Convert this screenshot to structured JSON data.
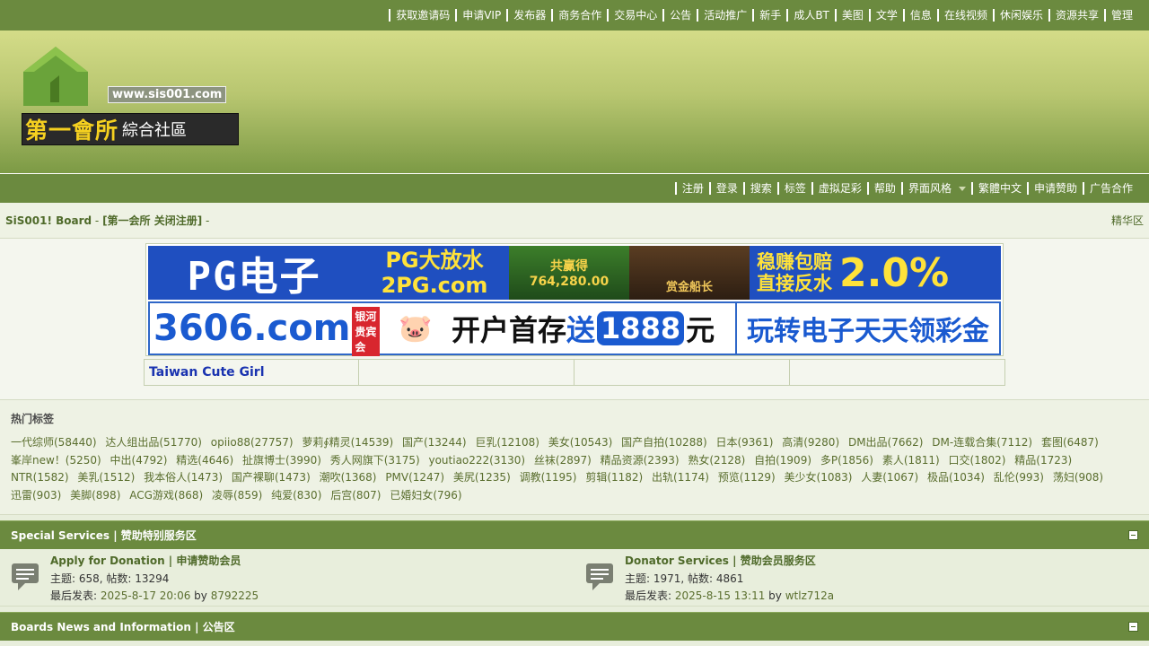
{
  "topnav": [
    "获取邀请码",
    "申请VIP",
    "发布器",
    "商务合作",
    "交易中心",
    "公告",
    "活动推广",
    "新手",
    "成人BT",
    "美图",
    "文学",
    "信息",
    "在线视频",
    "休闲娱乐",
    "资源共享",
    "管理"
  ],
  "logo": {
    "url": "www.sis001.com",
    "big": "第一會所",
    "small": "綜合社區"
  },
  "nav2": [
    "注册",
    "登录",
    "搜索",
    "标签",
    "虚拟足彩",
    "帮助",
    "界面风格",
    "繁體中文",
    "申请赞助",
    "广告合作"
  ],
  "breadcrumb": {
    "board": "SiS001! Board",
    "sep": " - ",
    "sub": "[第一会所 关闭注册]",
    "tail": " -",
    "right": "精华区"
  },
  "ads": {
    "ad1": {
      "pg": "PG电子",
      "pg2a": "PG大放水",
      "pg2b": "2PG.com",
      "win_a": "共赢得",
      "win_b": "764,280.00",
      "ship": "赏金船长",
      "bonus_a": "稳赚包赔",
      "bonus_b": "直接反水",
      "bonus_pct": "2.0%"
    },
    "ad2": {
      "site": "3606.com",
      "tag": "银河贵宾会",
      "pig": "🐷",
      "m1": "开户首存",
      "m2": "送",
      "m3": "1888",
      "m4": "元",
      "right": "玩转电子天天领彩金"
    },
    "link1": "Taiwan Cute Girl"
  },
  "tags": {
    "title": "热门标签",
    "items": [
      "一代综师(58440)",
      "达人组出品(51770)",
      "opiio88(27757)",
      "萝莉∮精灵(14539)",
      "国产(13244)",
      "巨乳(12108)",
      "美女(10543)",
      "国产自拍(10288)",
      "日本(9361)",
      "高清(9280)",
      "DM出品(7662)",
      "DM-连载合集(7112)",
      "套图(6487)",
      "峯岸new！(5250)",
      "中出(4792)",
      "精选(4646)",
      "扯旗博士(3990)",
      "秀人网旗下(3175)",
      "youtiao222(3130)",
      "丝袜(2897)",
      "精品资源(2393)",
      "熟女(2128)",
      "自拍(1909)",
      "多P(1856)",
      "素人(1811)",
      "口交(1802)",
      "精品(1723)",
      "NTR(1582)",
      "美乳(1512)",
      "我本俗人(1473)",
      "国产裸聊(1473)",
      "潮吹(1368)",
      "PMV(1247)",
      "美尻(1235)",
      "调教(1195)",
      "剪辑(1182)",
      "出轨(1174)",
      "预览(1129)",
      "美少女(1083)",
      "人妻(1067)",
      "极品(1034)",
      "乱伦(993)",
      "荡妇(908)",
      "迅雷(903)",
      "美脚(898)",
      "ACG游戏(868)",
      "凌辱(859)",
      "纯爱(830)",
      "后宫(807)",
      "已婚妇女(796)"
    ]
  },
  "categories": [
    {
      "title": "Special Services | 赞助特别服务区",
      "forums": [
        {
          "name": "Apply for Donation",
          "sep": " | ",
          "cn": "申请赞助会员",
          "stats": "主题: 658, 帖数: 13294",
          "last_label": "最后发表: ",
          "date": "2025-8-17 20:06",
          "by": " by ",
          "user": "8792225"
        },
        {
          "name": "Donator Services",
          "sep": " | ",
          "cn": "赞助会员服务区",
          "stats": "主题: 1971, 帖数: 4861",
          "last_label": "最后发表: ",
          "date": "2025-8-15 13:11",
          "by": " by ",
          "user": "wtlz712a"
        }
      ]
    },
    {
      "title": "Boards News and Information | 公告区",
      "forums": []
    }
  ]
}
